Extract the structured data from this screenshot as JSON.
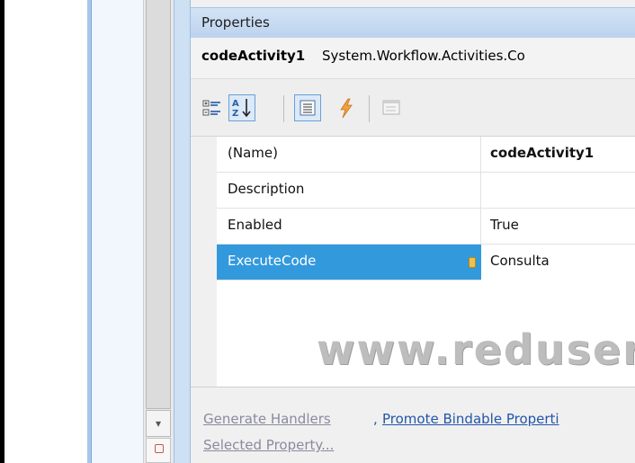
{
  "panel": {
    "title": "Properties",
    "object_name": "codeActivity1",
    "object_type": "System.Workflow.Activities.Co"
  },
  "toolbar": {
    "buttons": [
      {
        "icon": "categorized-icon"
      },
      {
        "icon": "alphabetical-sort-icon",
        "active": true
      },
      {
        "icon": "properties-icon",
        "active": true
      },
      {
        "icon": "events-lightning-icon"
      },
      {
        "icon": "property-pages-icon",
        "disabled": true
      }
    ]
  },
  "grid": {
    "rows": [
      {
        "name": "(Name)",
        "value": "codeActivity1",
        "bold": true
      },
      {
        "name": "Description",
        "value": ""
      },
      {
        "name": "Enabled",
        "value": "True"
      },
      {
        "name": "ExecuteCode",
        "value": "Consulta",
        "selected": true
      }
    ]
  },
  "watermark": "www.reduser",
  "commands": {
    "generate_handlers": "Generate Handlers",
    "comma": ",",
    "promote_bindable": "Promote Bindable Properti",
    "selected_property": "Selected Property..."
  },
  "colors": {
    "selection": "#3399dd",
    "title_bar": "#c7dbf2",
    "link": "#2255aa"
  }
}
